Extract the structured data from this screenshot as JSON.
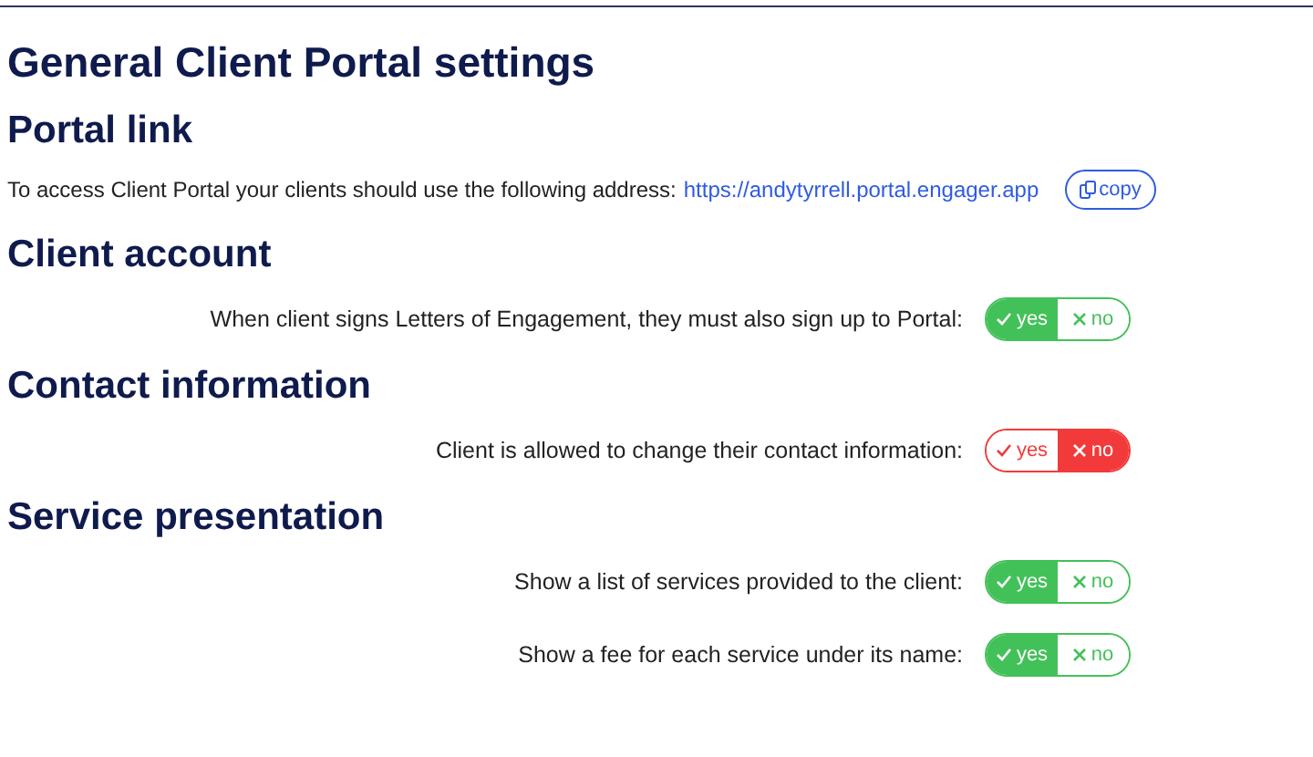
{
  "title": "General Client Portal settings",
  "sections": [
    {
      "heading": "Portal link",
      "kind": "link",
      "text": "To access Client Portal your clients should use the following address:",
      "url": "https://andytyrrell.portal.engager.app",
      "copy_label": "copy"
    },
    {
      "heading": "Client account",
      "kind": "settings",
      "settings": [
        {
          "label": "When client signs Letters of Engagement, they must also sign up to Portal:",
          "options": [
            {
              "kind": "yes",
              "label": "yes",
              "selected": true
            },
            {
              "kind": "no",
              "label": "no",
              "selected": false
            }
          ]
        }
      ]
    },
    {
      "heading": "Contact information",
      "kind": "settings",
      "settings": [
        {
          "label": "Client is allowed to change their contact information:",
          "options": [
            {
              "kind": "yes",
              "label": "yes",
              "selected": false
            },
            {
              "kind": "no",
              "label": "no",
              "selected": true
            }
          ]
        }
      ]
    },
    {
      "heading": "Service presentation",
      "kind": "settings",
      "settings": [
        {
          "label": "Show a list of services provided to the client:",
          "options": [
            {
              "kind": "yes",
              "label": "yes",
              "selected": true
            },
            {
              "kind": "no",
              "label": "no",
              "selected": false
            }
          ]
        },
        {
          "label": "Show a fee for each service under its name:",
          "options": [
            {
              "kind": "yes",
              "label": "yes",
              "selected": true
            },
            {
              "kind": "no",
              "label": "no",
              "selected": false
            }
          ]
        }
      ]
    }
  ]
}
